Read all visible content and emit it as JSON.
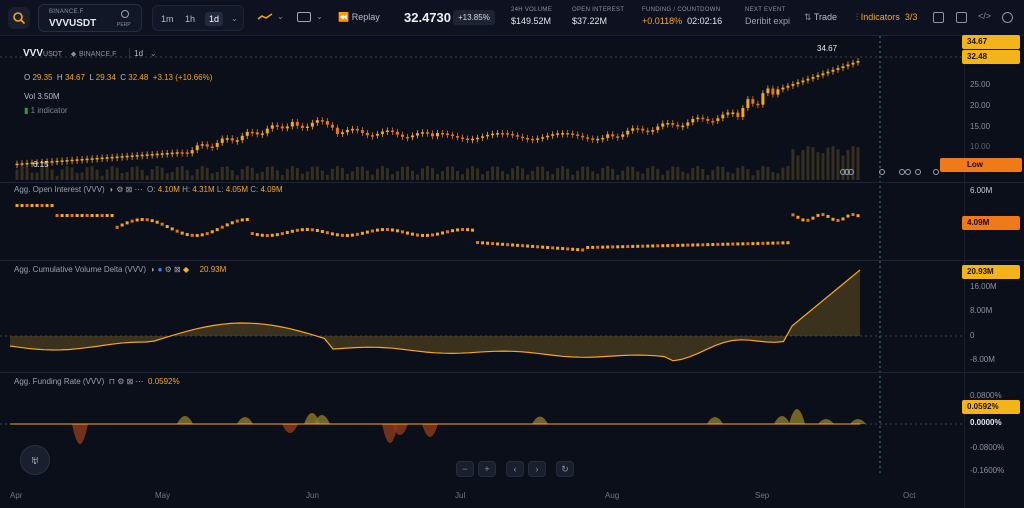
{
  "header": {
    "exchange": "BINANCE.F",
    "symbol": "VVVUSDT",
    "market_type": "PERP",
    "timeframes": [
      "1m",
      "1h",
      "1d"
    ],
    "active_timeframe": "1d",
    "replay_label": "Replay",
    "last_price": "32.4730",
    "change_pct": "+13.85%",
    "stats": [
      {
        "label": "24H VOLUME",
        "value": "$149.52M"
      },
      {
        "label": "OPEN INTEREST",
        "value": "$37.22M"
      },
      {
        "label": "FUNDING / COUNTDOWN",
        "value_a": "+0.0118%",
        "value_b": "02:02:16"
      },
      {
        "label": "NEXT EVENT",
        "value": "Deribit expi"
      }
    ],
    "trade_label": "Trade",
    "indicators_label": "Indicators",
    "indicators_count": "3/3"
  },
  "main_pane": {
    "symbol": "VVV",
    "quote": "USDT",
    "exchange": "BINANCE.F",
    "timeframe": "1d",
    "ohlc": {
      "o": "29.35",
      "h": "34.67",
      "l": "29.34",
      "c": "32.48",
      "change": "+3.13 (+10.66%)"
    },
    "volume": "Vol 3.50M",
    "indicator_note": "1 indicator",
    "high_marker": "34.67",
    "low_marker": "6.15",
    "axis_labels": [
      "25.00",
      "20.00",
      "15.00",
      "10.00"
    ],
    "tags": {
      "high": "34.67",
      "price": "32.48",
      "low_label": "Low",
      "low": "6.15"
    }
  },
  "oi_pane": {
    "title": "Agg. Open Interest (VVV)",
    "o": "4.10M",
    "h": "4.31M",
    "l": "4.05M",
    "c": "4.09M",
    "axis_labels": [
      "6.00M"
    ],
    "tag": "4.09M"
  },
  "cvd_pane": {
    "title": "Agg. Cumulative Volume Delta (VVV)",
    "value": "20.93M",
    "axis_labels": [
      "16.00M",
      "8.00M",
      "0",
      "-8.00M"
    ],
    "tag": "20.93M"
  },
  "funding_pane": {
    "title": "Agg. Funding Rate (VVV)",
    "value": "0.0592%",
    "axis_labels": [
      "0.0800%",
      "-0.0800%",
      "-0.1600%"
    ],
    "tag": "0.0592%",
    "zero_tag": "0.0000%"
  },
  "x_axis": [
    "Apr",
    "May",
    "Jun",
    "Jul",
    "Aug",
    "Sep",
    "Oct"
  ],
  "colors": {
    "bull": "#f5a623",
    "bear": "#e8741c",
    "accent": "#f5a623",
    "bg": "#0b0f1a"
  }
}
